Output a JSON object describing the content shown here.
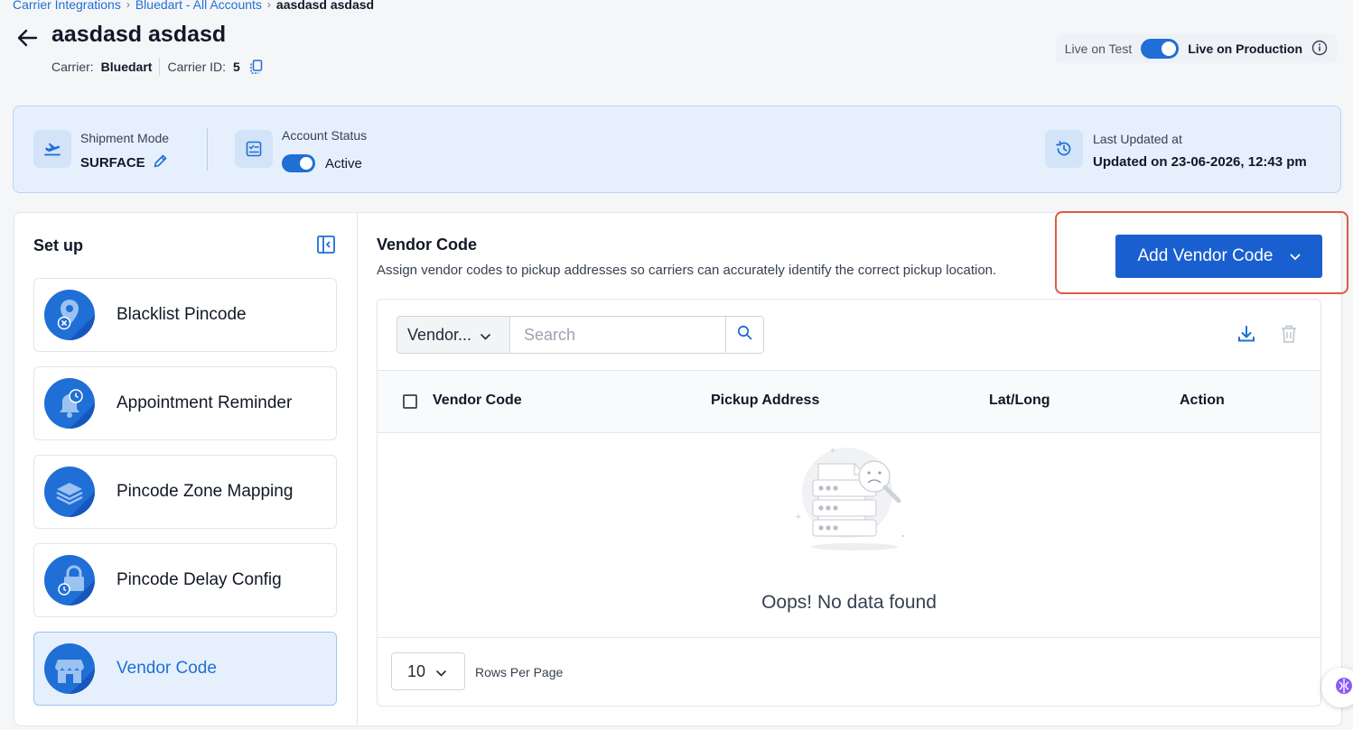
{
  "breadcrumb": {
    "items": [
      "Carrier Integrations",
      "Bluedart - All Accounts"
    ],
    "current": "aasdasd asdasd"
  },
  "header": {
    "title": "aasdasd asdasd",
    "carrier_label": "Carrier:",
    "carrier_value": "Bluedart",
    "carrier_id_label": "Carrier ID:",
    "carrier_id_value": "5"
  },
  "live_toggle": {
    "test_label": "Live on Test",
    "prod_label": "Live on Production",
    "enabled": true
  },
  "summary": {
    "shipment_mode_label": "Shipment Mode",
    "shipment_mode_value": "SURFACE",
    "account_status_label": "Account Status",
    "account_status_value": "Active",
    "last_updated_label": "Last Updated at",
    "last_updated_value": "Updated on 23-06-2026, 12:43 pm"
  },
  "setup": {
    "title": "Set up",
    "items": [
      {
        "label": "Blacklist Pincode",
        "icon": "blacklist-pin-icon"
      },
      {
        "label": "Appointment Reminder",
        "icon": "bell-clock-icon"
      },
      {
        "label": "Pincode Zone Mapping",
        "icon": "layers-icon"
      },
      {
        "label": "Pincode Delay Config",
        "icon": "lock-icon"
      },
      {
        "label": "Vendor Code",
        "icon": "store-icon"
      }
    ],
    "active_index": 4
  },
  "vendor": {
    "title": "Vendor Code",
    "description": "Assign vendor codes to pickup addresses so carriers can accurately identify the correct pickup location.",
    "add_button": "Add Vendor Code"
  },
  "table": {
    "filter_value": "Vendor...",
    "search_placeholder": "Search",
    "columns": [
      "Vendor Code",
      "Pickup Address",
      "Lat/Long",
      "Action"
    ],
    "empty_text": "Oops! No data found",
    "rows_per_page_value": "10",
    "rows_per_page_label": "Rows Per Page"
  },
  "colors": {
    "primary": "#1f6fd6",
    "highlight_border": "#e05a45",
    "summary_bg": "#e6f0fd"
  }
}
